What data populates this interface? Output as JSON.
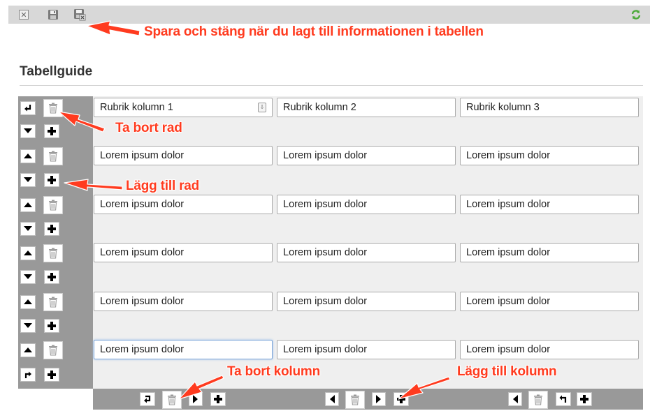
{
  "annotations": {
    "save_close": "Spara och stäng när du lagt till informationen i tabellen",
    "remove_row": "Ta bort rad",
    "add_row": "Lägg till rad",
    "remove_column": "Ta bort kolumn",
    "add_column": "Lägg till kolumn"
  },
  "page": {
    "title": "Tabellguide"
  },
  "table": {
    "header": [
      "Rubrik kolumn 1",
      "Rubrik kolumn 2",
      "Rubrik kolumn 3"
    ],
    "rows": [
      [
        "Lorem ipsum dolor",
        "Lorem ipsum dolor",
        "Lorem ipsum dolor"
      ],
      [
        "Lorem ipsum dolor",
        "Lorem ipsum dolor",
        "Lorem ipsum dolor"
      ],
      [
        "Lorem ipsum dolor",
        "Lorem ipsum dolor",
        "Lorem ipsum dolor"
      ],
      [
        "Lorem ipsum dolor",
        "Lorem ipsum dolor",
        "Lorem ipsum dolor"
      ],
      [
        "Lorem ipsum dolor",
        "Lorem ipsum dolor",
        "Lorem ipsum dolor"
      ]
    ]
  },
  "icons": {
    "close": "close-icon",
    "save": "save-icon",
    "save_close": "save-close-icon",
    "refresh": "refresh-icon",
    "trash": "trash-icon",
    "up": "arrow-up-icon",
    "down": "arrow-down-icon",
    "plus": "plus-icon",
    "left": "arrow-left-icon",
    "right": "arrow-right-icon"
  },
  "colors": {
    "annotation": "#ff3b1f",
    "strip": "#999999",
    "grid": "#efefef",
    "toolbar": "#d8d8d8",
    "focus": "#7da6d9"
  }
}
